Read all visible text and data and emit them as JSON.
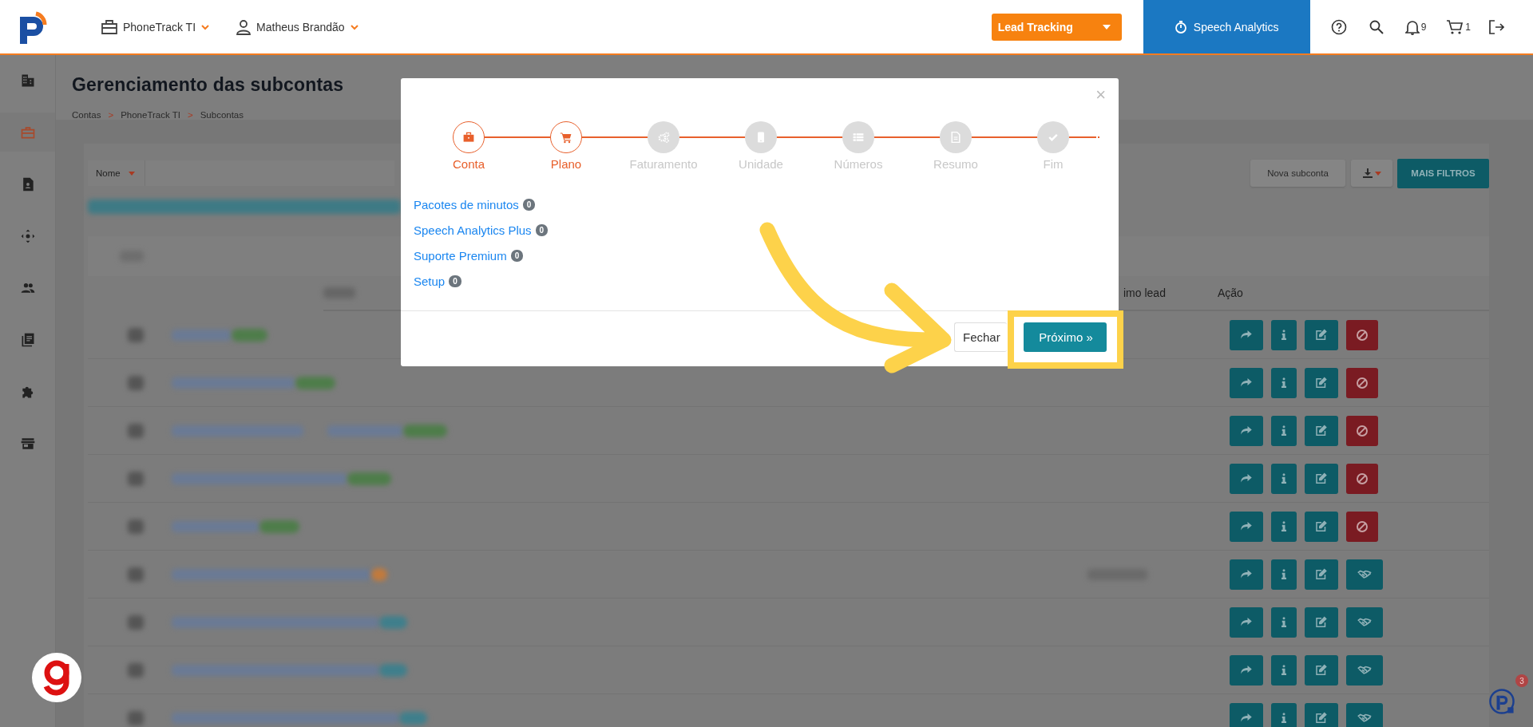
{
  "topbar": {
    "account_menu": "PhoneTrack TI",
    "user_menu": "Matheus Brandão",
    "product_select": "Lead Tracking",
    "speech_button": "Speech Analytics",
    "notifications": "9",
    "cart": "1"
  },
  "sidebar": {
    "items": [
      {
        "kind": "building",
        "selected": false
      },
      {
        "kind": "briefcase",
        "selected": true
      },
      {
        "kind": "contact",
        "selected": false
      },
      {
        "kind": "move",
        "selected": false
      },
      {
        "kind": "people",
        "selected": false
      },
      {
        "kind": "library",
        "selected": false
      },
      {
        "kind": "puzzle",
        "selected": false
      },
      {
        "kind": "store",
        "selected": false
      }
    ]
  },
  "page": {
    "title": "Gerenciamento das subcontas",
    "breadcrumbs": [
      "Contas",
      "PhoneTrack TI",
      "Subcontas"
    ],
    "separator": ">"
  },
  "toolbar": {
    "filter_field": "Nome",
    "new_button": "Nova subconta",
    "filters_button": "MAIS FILTROS"
  },
  "table": {
    "columns": [
      "imo lead",
      "Ação"
    ],
    "rows": [
      {
        "tag": {
          "color": "#4e7d4a"
        },
        "actions": [
          {
            "kind": "forward"
          },
          {
            "kind": "info"
          },
          {
            "kind": "edit"
          },
          {
            "kind": "block"
          }
        ]
      },
      {
        "tag": {
          "color": "#4e7d4a"
        },
        "actions": [
          {
            "kind": "forward"
          },
          {
            "kind": "info"
          },
          {
            "kind": "edit"
          },
          {
            "kind": "block"
          }
        ]
      },
      {
        "tag": {
          "color": "#4e7d4a"
        },
        "actions": [
          {
            "kind": "forward"
          },
          {
            "kind": "info"
          },
          {
            "kind": "edit"
          },
          {
            "kind": "block"
          }
        ]
      },
      {
        "tag": {
          "color": "#4e7d4a"
        },
        "actions": [
          {
            "kind": "forward"
          },
          {
            "kind": "info"
          },
          {
            "kind": "edit"
          },
          {
            "kind": "block"
          }
        ]
      },
      {
        "tag": {
          "color": "#4e7d4a"
        },
        "actions": [
          {
            "kind": "forward"
          },
          {
            "kind": "info"
          },
          {
            "kind": "edit"
          },
          {
            "kind": "block"
          }
        ]
      },
      {
        "tag": {
          "color": "#c27a3c"
        },
        "actions": [
          {
            "kind": "forward"
          },
          {
            "kind": "info"
          },
          {
            "kind": "edit"
          },
          {
            "kind": "handshake"
          }
        ]
      },
      {
        "tag": {
          "color": "#3f7f8c"
        },
        "actions": [
          {
            "kind": "forward"
          },
          {
            "kind": "info"
          },
          {
            "kind": "edit"
          },
          {
            "kind": "handshake"
          }
        ]
      },
      {
        "tag": {
          "color": "#3f7f8c"
        },
        "actions": [
          {
            "kind": "forward"
          },
          {
            "kind": "info"
          },
          {
            "kind": "edit"
          },
          {
            "kind": "handshake"
          }
        ]
      },
      {
        "tag": {
          "color": "#3f7f8c"
        },
        "actions": [
          {
            "kind": "forward"
          },
          {
            "kind": "info"
          },
          {
            "kind": "edit"
          },
          {
            "kind": "handshake"
          }
        ]
      }
    ]
  },
  "modal": {
    "close": "×",
    "steps": [
      {
        "label": "Conta",
        "kind": "briefcase",
        "active": true
      },
      {
        "label": "Plano",
        "kind": "cart",
        "active": true
      },
      {
        "label": "Faturamento",
        "kind": "gears",
        "active": false
      },
      {
        "label": "Unidade",
        "kind": "tablet",
        "active": false
      },
      {
        "label": "Números",
        "kind": "list",
        "active": false
      },
      {
        "label": "Resumo",
        "kind": "document",
        "active": false
      },
      {
        "label": "Fim",
        "kind": "check",
        "active": false
      }
    ],
    "items": [
      {
        "label": "Pacotes de minutos",
        "count": "0"
      },
      {
        "label": "Speech Analytics Plus",
        "count": "0"
      },
      {
        "label": "Suporte Premium",
        "count": "0"
      },
      {
        "label": "Setup",
        "count": "0"
      }
    ],
    "buttons": [
      {
        "label": "Fechar",
        "kind": "secondary"
      },
      {
        "label": "Próximo »",
        "kind": "primary"
      }
    ]
  },
  "chat_widget": {
    "badge": "3"
  }
}
